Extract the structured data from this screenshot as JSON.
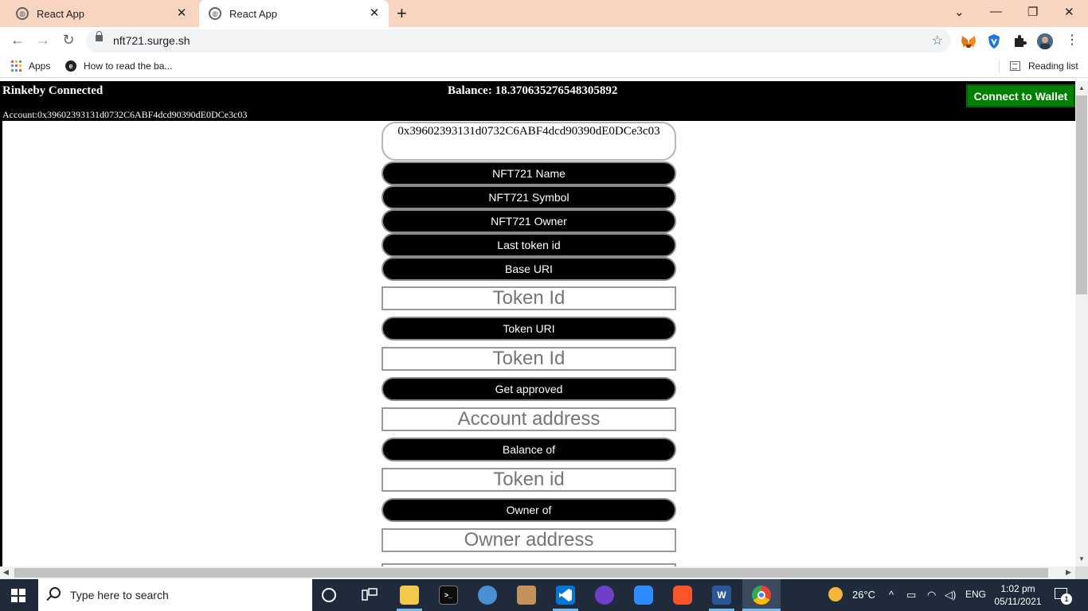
{
  "browser": {
    "tabs": [
      {
        "title": "React App",
        "active": false
      },
      {
        "title": "React App",
        "active": true
      }
    ],
    "new_tab": "+",
    "url": "nft721.surge.sh",
    "bookmarks": {
      "apps_label": "Apps",
      "items": [
        {
          "label": "How to read the ba..."
        }
      ],
      "reading_list_label": "Reading list"
    }
  },
  "app": {
    "header": {
      "network": "Rinkeby Connected",
      "balance": "Balance: 18.370635276548305892",
      "account": "Account:0x39602393131d0732C6ABF4dcd90390dE0DCe3c03",
      "connect_button": "Connect to Wallet"
    },
    "address_input_value": "0x39602393131d0732C6ABF4dcd90390dE0DCe3c03",
    "buttons": {
      "name": "NFT721 Name",
      "symbol": "NFT721 Symbol",
      "owner": "NFT721 Owner",
      "last_token_id": "Last token id",
      "base_uri": "Base URI",
      "token_uri": "Token URI",
      "get_approved": "Get approved",
      "balance_of": "Balance of",
      "owner_of": "Owner of"
    },
    "placeholders": {
      "token_uri_input": "Token Id",
      "get_approved_input": "Token Id",
      "balance_of_input": "Account address",
      "owner_of_input": "Token id",
      "next_input": "Owner address"
    }
  },
  "taskbar": {
    "search_placeholder": "Type here to search",
    "weather": "26°C",
    "language": "ENG",
    "time": "1:02 pm",
    "date": "05/11/2021",
    "notification_count": "1"
  },
  "colors": {
    "tab_strip": "#f8d5c1",
    "header_bg": "#000000",
    "connect_button": "#008000",
    "taskbar": "#1f2b3a"
  }
}
